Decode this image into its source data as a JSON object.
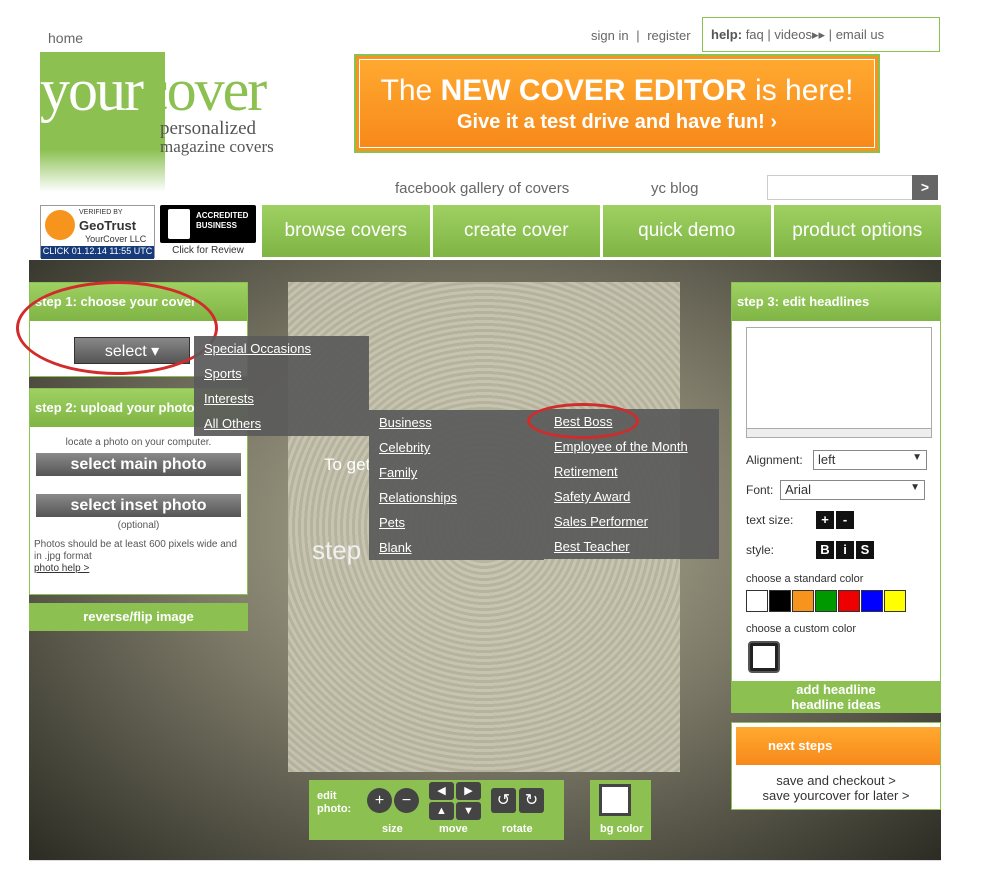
{
  "header": {
    "home": "home",
    "sign_in": "sign in",
    "separator": "|",
    "register": "register",
    "help_label": "help:",
    "faq": "faq",
    "videos": "videos",
    "email_us": "email us",
    "logo_your": "your",
    "logo_cover": "cover",
    "tagline1": "personalized",
    "tagline2": "magazine covers",
    "banner_line1_pre": "The ",
    "banner_line1_bold": "NEW COVER EDITOR",
    "banner_line1_post": " is here!",
    "banner_line2": "Give it a test drive and have fun! ›",
    "facebook_gallery": "facebook gallery of covers",
    "yc_blog": "yc blog",
    "search_go": ">",
    "geotrust_top": "VERIFIED BY",
    "geotrust_brand": "GeoTrust",
    "geotrust_company": "YourCover LLC",
    "geotrust_date": "CLICK 01.12.14 11:55 UTC",
    "bbb_line1": "ACCREDITED",
    "bbb_line2": "BUSINESS",
    "bbb_review": "Click for Review"
  },
  "nav": [
    "browse covers",
    "create cover",
    "quick demo",
    "product options"
  ],
  "step1": {
    "title": "step 1: choose your cover",
    "select_label": "select"
  },
  "step2": {
    "title": "step 2: upload your photo",
    "locate": "locate a photo on your computer.",
    "main_photo": "select main photo",
    "inset_photo": "select inset photo",
    "optional": "(optional)",
    "requirements": "Photos should be at least 600 pixels wide and in .jpg format",
    "photo_help": "photo help >",
    "reverse": "reverse/flip image"
  },
  "menu1": [
    "Special Occasions",
    "Sports",
    "Interests",
    "All Others"
  ],
  "menu2": [
    "Business",
    "Celebrity",
    "Family",
    "Relationships",
    "Pets",
    "Blank"
  ],
  "menu3": [
    "Best Boss",
    "Employee of the Month",
    "Retirement",
    "Safety Award",
    "Sales Performer",
    "Best Teacher"
  ],
  "canvas": {
    "line1": "To get",
    "line2": "step"
  },
  "toolbar": {
    "edit_photo": "edit photo:",
    "size": "size",
    "move": "move",
    "rotate": "rotate",
    "bg_color": "bg color"
  },
  "step3": {
    "title": "step 3: edit headlines",
    "alignment_label": "Alignment:",
    "alignment_value": "left",
    "font_label": "Font:",
    "font_value": "Arial",
    "text_size_label": "text size:",
    "plus": "+",
    "minus": "-",
    "style_label": "style:",
    "bold": "B",
    "italic": "i",
    "strike": "S",
    "standard_color": "choose a standard color",
    "custom_color": "choose a custom color",
    "add_headline": "add headline",
    "headline_ideas": "headline ideas",
    "colors": [
      "#ffffff",
      "#000000",
      "#f7941d",
      "#009900",
      "#ee0000",
      "#0000ff",
      "#ffff00"
    ]
  },
  "next": {
    "title": "next steps",
    "save_checkout": "save and checkout >",
    "save_later": "save yourcover for later >"
  }
}
